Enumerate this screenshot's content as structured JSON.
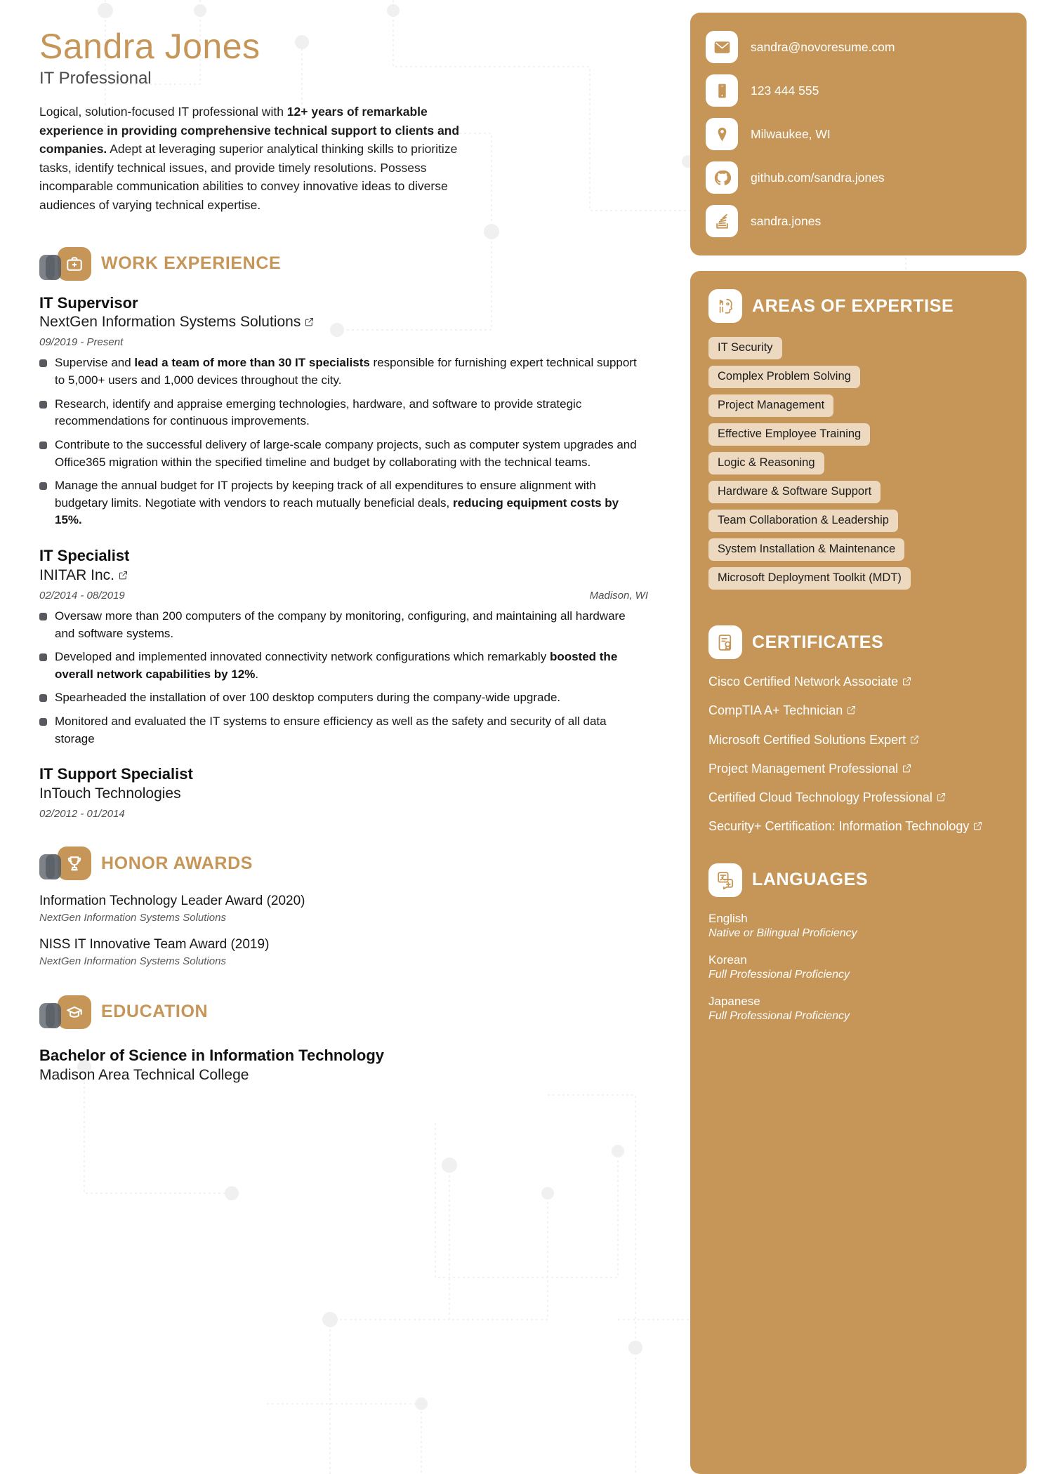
{
  "header": {
    "name": "Sandra Jones",
    "role": "IT Professional",
    "summary_part1": "Logical, solution-focused IT professional with ",
    "summary_bold": "12+ years of remarkable experience in providing comprehensive technical support to clients and companies.",
    "summary_part2": " Adept at leveraging superior analytical thinking skills to prioritize tasks, identify technical issues, and provide timely resolutions. Possess incomparable communication abilities to convey innovative ideas to diverse audiences of varying technical expertise."
  },
  "contact": {
    "items": [
      {
        "icon": "email-icon",
        "value": "sandra@novoresume.com"
      },
      {
        "icon": "phone-icon",
        "value": "123 444 555"
      },
      {
        "icon": "location-pin-icon",
        "value": "Milwaukee, WI"
      },
      {
        "icon": "github-icon",
        "value": "github.com/sandra.jones"
      },
      {
        "icon": "stackoverflow-icon",
        "value": "sandra.jones"
      }
    ]
  },
  "work_experience": {
    "section_title": "WORK EXPERIENCE",
    "section_icon": "briefcase-icon",
    "jobs": [
      {
        "title": "IT Supervisor",
        "company": "NextGen Information Systems Solutions",
        "has_link": true,
        "dates": "09/2019 - Present",
        "location": "",
        "bullets": [
          {
            "pre": "Supervise and ",
            "bold": "lead a team of more than 30 IT specialists",
            "post": " responsible for furnishing expert technical support to 5,000+ users and 1,000 devices throughout the city."
          },
          {
            "pre": "Research, identify and appraise emerging technologies, hardware, and software to provide strategic recommendations for continuous improvements.",
            "bold": "",
            "post": ""
          },
          {
            "pre": "Contribute to the successful delivery of large-scale company projects, such as computer system upgrades and Office365 migration within the specified timeline and budget by collaborating with the technical teams.",
            "bold": "",
            "post": ""
          },
          {
            "pre": "Manage the annual budget for IT projects by keeping track of all expenditures to ensure alignment with budgetary limits. Negotiate with vendors to reach mutually beneficial deals, ",
            "bold": "reducing equipment costs by 15%.",
            "post": ""
          }
        ]
      },
      {
        "title": "IT Specialist",
        "company": "INITAR Inc.",
        "has_link": true,
        "dates": "02/2014 - 08/2019",
        "location": "Madison, WI",
        "bullets": [
          {
            "pre": "Oversaw more than 200 computers of the company by monitoring, configuring, and maintaining all hardware and software systems.",
            "bold": "",
            "post": ""
          },
          {
            "pre": "Developed and implemented innovated connectivity network configurations which remarkably ",
            "bold": "boosted the overall network capabilities by 12%",
            "post": "."
          },
          {
            "pre": "Spearheaded the installation of over 100 desktop computers during the company-wide upgrade.",
            "bold": "",
            "post": ""
          },
          {
            "pre": "Monitored and evaluated the IT systems to ensure efficiency as well as the safety and security of all data storage",
            "bold": "",
            "post": ""
          }
        ]
      },
      {
        "title": "IT Support Specialist",
        "company": "InTouch Technologies",
        "has_link": false,
        "dates": "02/2012 - 01/2014",
        "location": "",
        "bullets": []
      }
    ]
  },
  "honor_awards": {
    "section_title": "HONOR AWARDS",
    "section_icon": "trophy-icon",
    "items": [
      {
        "name": "Information Technology Leader Award (2020)",
        "org": "NextGen Information Systems Solutions"
      },
      {
        "name": "NISS IT Innovative Team Award (2019)",
        "org": "NextGen Information Systems Solutions"
      }
    ]
  },
  "education": {
    "section_title": "EDUCATION",
    "section_icon": "graduation-cap-icon",
    "items": [
      {
        "degree": "Bachelor of Science in Information Technology",
        "school": "Madison Area Technical College"
      }
    ]
  },
  "expertise": {
    "section_title": "AREAS OF EXPERTISE",
    "section_icon": "brain-skills-icon",
    "tags": [
      "IT Security",
      "Complex Problem Solving",
      "Project Management",
      "Effective Employee Training",
      "Logic & Reasoning",
      "Hardware & Software Support",
      "Team Collaboration & Leadership",
      "System Installation & Maintenance",
      "Microsoft Deployment Toolkit (MDT)"
    ]
  },
  "certificates": {
    "section_title": "CERTIFICATES",
    "section_icon": "certificate-icon",
    "items": [
      "Cisco Certified Network Associate",
      "CompTIA A+ Technician",
      "Microsoft Certified Solutions Expert",
      "Project Management Professional",
      "Certified Cloud Technology Professional",
      "Security+ Certification: Information Technology"
    ]
  },
  "languages": {
    "section_title": "LANGUAGES",
    "section_icon": "translate-icon",
    "items": [
      {
        "name": "English",
        "level": "Native or Bilingual Proficiency"
      },
      {
        "name": "Korean",
        "level": "Full Professional Proficiency"
      },
      {
        "name": "Japanese",
        "level": "Full Professional Proficiency"
      }
    ]
  },
  "colors": {
    "accent": "#c59658",
    "tag_bg": "#ecd9bf",
    "text": "#141414"
  }
}
